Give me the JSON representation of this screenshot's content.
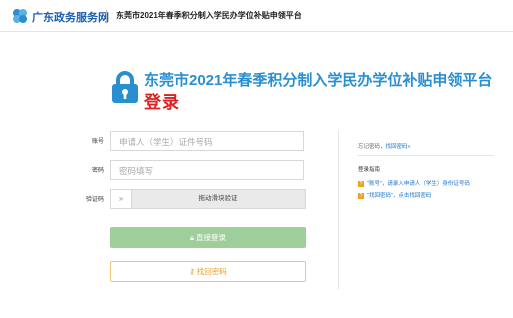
{
  "header": {
    "brand": "广东政务服务网",
    "title": "东莞市2021年春季积分制入学民办学位补贴申领平台"
  },
  "hero": {
    "title": "东莞市2021年春季积分制入学民办学位补贴申领平台",
    "subtitle": "登录"
  },
  "form": {
    "account_label": "账号",
    "account_placeholder": "申请人（学生）证件号码",
    "password_label": "密码",
    "password_placeholder": "密码填写",
    "captcha_label": "验证码",
    "slider_handle": "»",
    "slider_text": "拖动滑块验证",
    "login_button": "直接登录",
    "forgot_button": "找回密码"
  },
  "side": {
    "forgot_prefix": "忘记密码，",
    "forgot_link": "找回密码»",
    "guide_title": "登录指南",
    "guide_items": [
      "\"账号\"，请录入申请人（学生）身份证号码",
      "\"找回密码\"，点击找回密码"
    ]
  },
  "colors": {
    "accent": "#2a8fd0",
    "login_red": "#e02020",
    "login_button_bg": "#9ecf9a",
    "forgot_border": "#f1c77a"
  }
}
